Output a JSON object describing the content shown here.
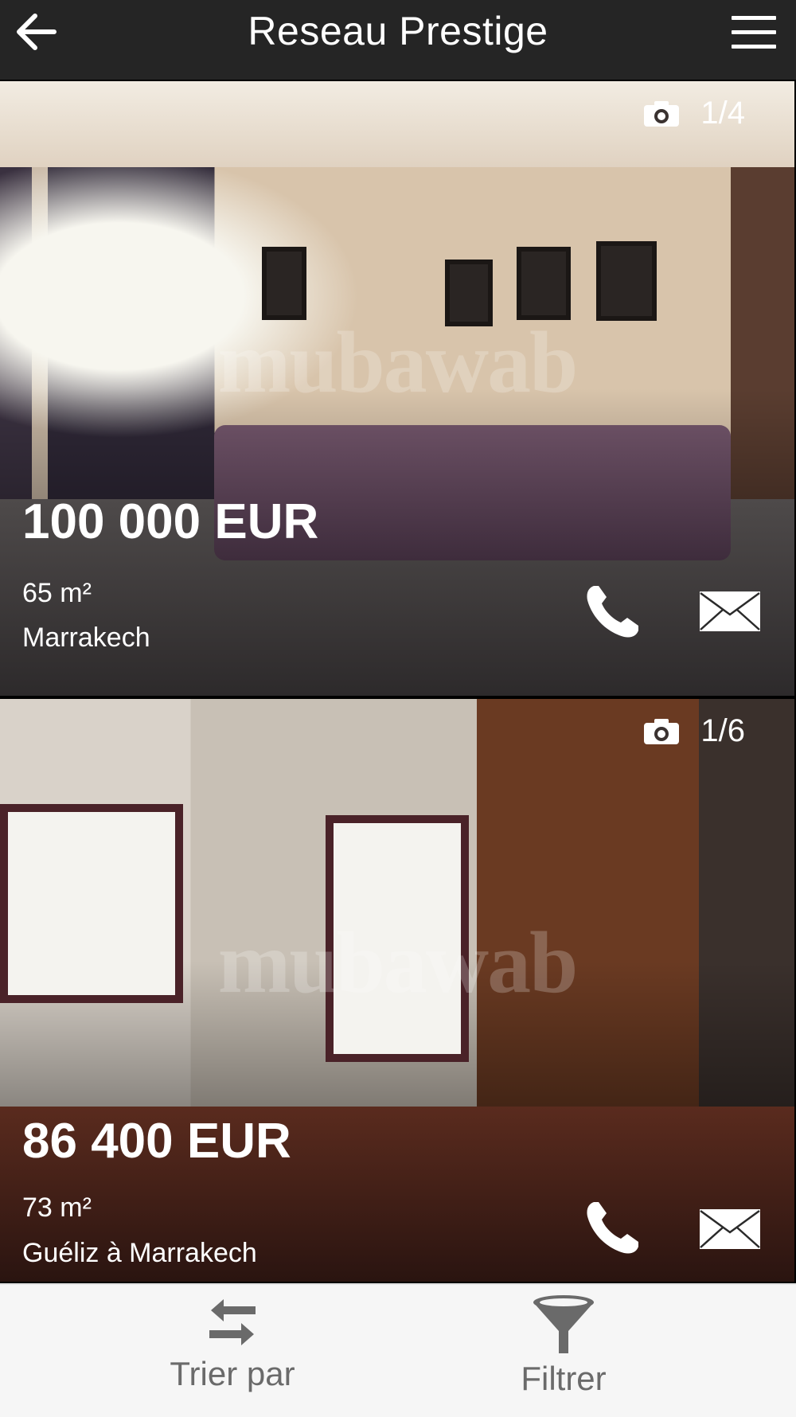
{
  "header": {
    "title": "Reseau Prestige"
  },
  "listings": [
    {
      "photo_counter": "1/4",
      "watermark": "mubawab",
      "price": "100 000 EUR",
      "area": "65 m²",
      "location": "Marrakech"
    },
    {
      "photo_counter": "1/6",
      "watermark": "mubawab",
      "price": "86 400 EUR",
      "area": "73 m²",
      "location": "Guéliz à Marrakech"
    }
  ],
  "bottom_bar": {
    "sort_label": "Trier par",
    "filter_label": "Filtrer"
  },
  "colors": {
    "header_bg": "#252525",
    "bottom_bar_bg": "#f6f6f6",
    "bottom_bar_text": "#6a6a6a"
  }
}
